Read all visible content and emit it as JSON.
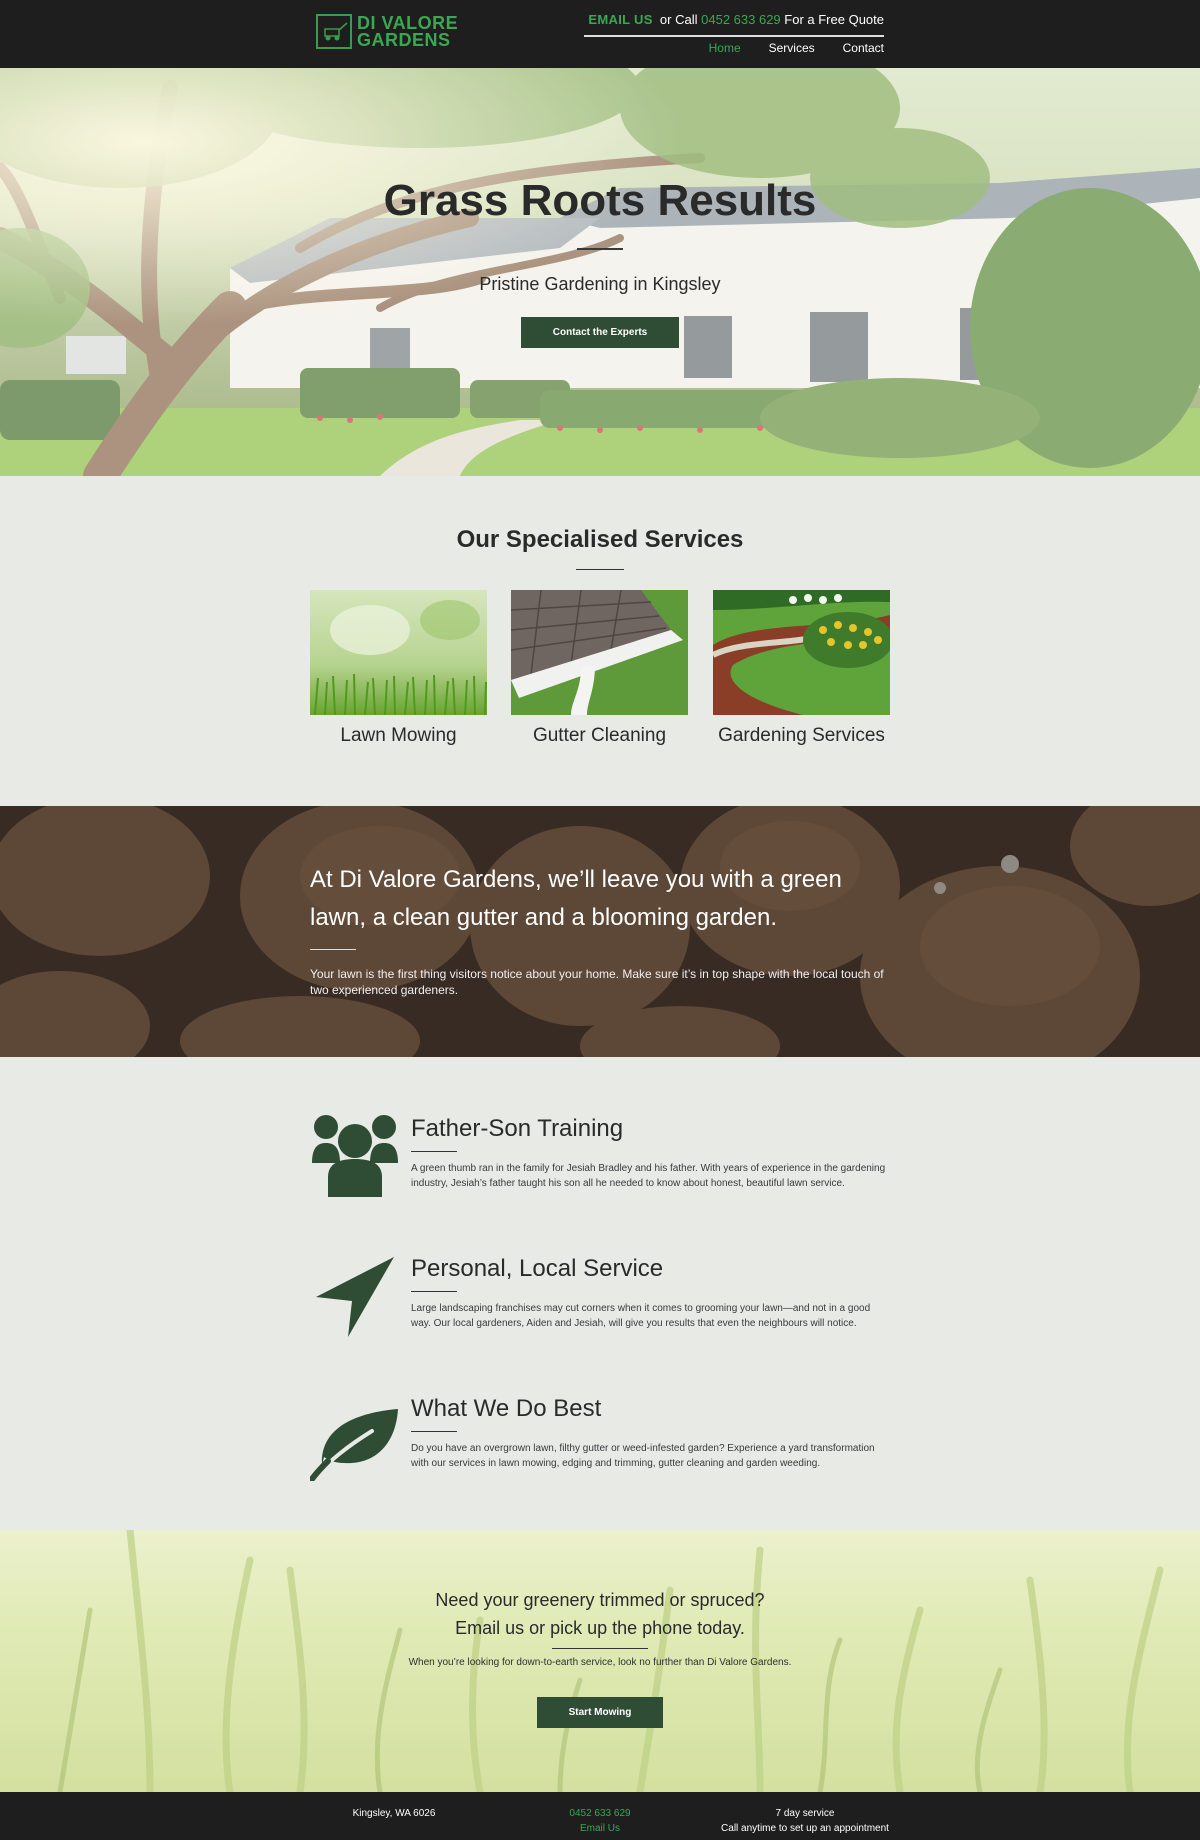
{
  "header": {
    "logo_line1": "DI VALORE",
    "logo_line2": "GARDENS",
    "email_label": "EMAIL US",
    "or_call": "or Call",
    "phone": "0452 633 629",
    "quote_text": "For a Free Quote",
    "nav": [
      {
        "label": "Home",
        "active": true
      },
      {
        "label": "Services",
        "active": false
      },
      {
        "label": "Contact",
        "active": false
      }
    ]
  },
  "hero": {
    "title": "Grass Roots Results",
    "subtitle": "Pristine Gardening in Kingsley",
    "button": "Contact the Experts"
  },
  "services": {
    "title": "Our Specialised Services",
    "items": [
      {
        "label": "Lawn Mowing"
      },
      {
        "label": "Gutter Cleaning"
      },
      {
        "label": "Gardening Services"
      }
    ]
  },
  "about": {
    "heading": "At Di Valore Gardens, we’ll leave you with a green lawn, a clean gutter and a blooming garden.",
    "body": "Your lawn is the first thing visitors notice about your home. Make sure it’s in top shape with the local touch of two experienced gardeners."
  },
  "features": [
    {
      "title": "Father-Son Training",
      "icon": "people-icon",
      "body": "A green thumb ran in the family for Jesiah Bradley and his father. With years of experience in the gardening industry, Jesiah’s father taught his son all he needed to know about honest, beautiful lawn service."
    },
    {
      "title": "Personal, Local Service",
      "icon": "location-arrow-icon",
      "body": "Large landscaping franchises may cut corners when it comes to grooming your lawn—and not in a good way. Our local gardeners, Aiden and Jesiah, will give you results that even the neighbours will notice."
    },
    {
      "title": "What We Do Best",
      "icon": "leaf-icon",
      "body": "Do you have an overgrown lawn, filthy gutter or weed-infested garden? Experience a yard transformation with our services in lawn mowing, edging and trimming, gutter cleaning and garden weeding."
    }
  ],
  "cta": {
    "line1": "Need your greenery trimmed or spruced?",
    "line2": "Email us or pick up the phone today.",
    "body": "When you’re looking for down-to-earth service, look no further than Di Valore Gardens.",
    "button": "Start Mowing"
  },
  "footer": {
    "address": "Kingsley, WA 6026",
    "phone": "0452 633 629",
    "email": "Email Us",
    "service_title": "7 day service",
    "service_text": "Call anytime to set up an appointment"
  },
  "colors": {
    "brand_green": "#3aa853",
    "button_green": "#2e4d34",
    "icon_green": "#2e4d34",
    "header_bg": "#1e1e1e",
    "page_bg": "#e8eae6"
  }
}
